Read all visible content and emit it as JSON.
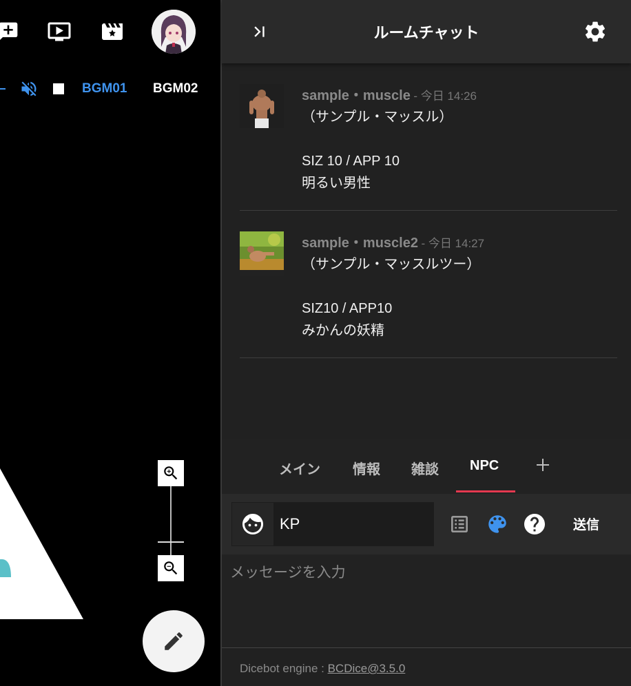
{
  "toolbar": {
    "icons": [
      "add-comment-icon",
      "screen-play-icon",
      "movie-sparkle-icon"
    ],
    "avatar": "user-avatar"
  },
  "audio": {
    "mute_icon": "volume-off-icon",
    "stop_icon": "stop-icon",
    "bgm1": "BGM01",
    "bgm2": "BGM02",
    "bgm1_color": "#3f93ee",
    "bgm2_color": "#ffffff"
  },
  "zoom": {
    "in_icon": "zoom-in-icon",
    "out_icon": "zoom-out-icon"
  },
  "fab": {
    "icon": "pencil-icon"
  },
  "chat": {
    "title": "ルームチャット",
    "messages": [
      {
        "name": "sample・muscle",
        "time": "- 今日 14:26",
        "body": "（サンプル・マッスル）\n\nSIZ 10 / APP 10\n明るい男性"
      },
      {
        "name": "sample・muscle2",
        "time": "- 今日 14:27",
        "body": "（サンプル・マッスルツー）\n\nSIZ10 / APP10\nみかんの妖精"
      }
    ],
    "tabs": [
      "メイン",
      "情報",
      "雑談",
      "NPC"
    ],
    "active_tab": "NPC",
    "accent": "#e53950",
    "sender_name": "KP",
    "send_label": "送信",
    "input_placeholder": "メッセージを入力",
    "palette_color": "#3f93ee",
    "footer_prefix": "Dicebot engine : ",
    "footer_link": "BCDice@3.5.0"
  }
}
